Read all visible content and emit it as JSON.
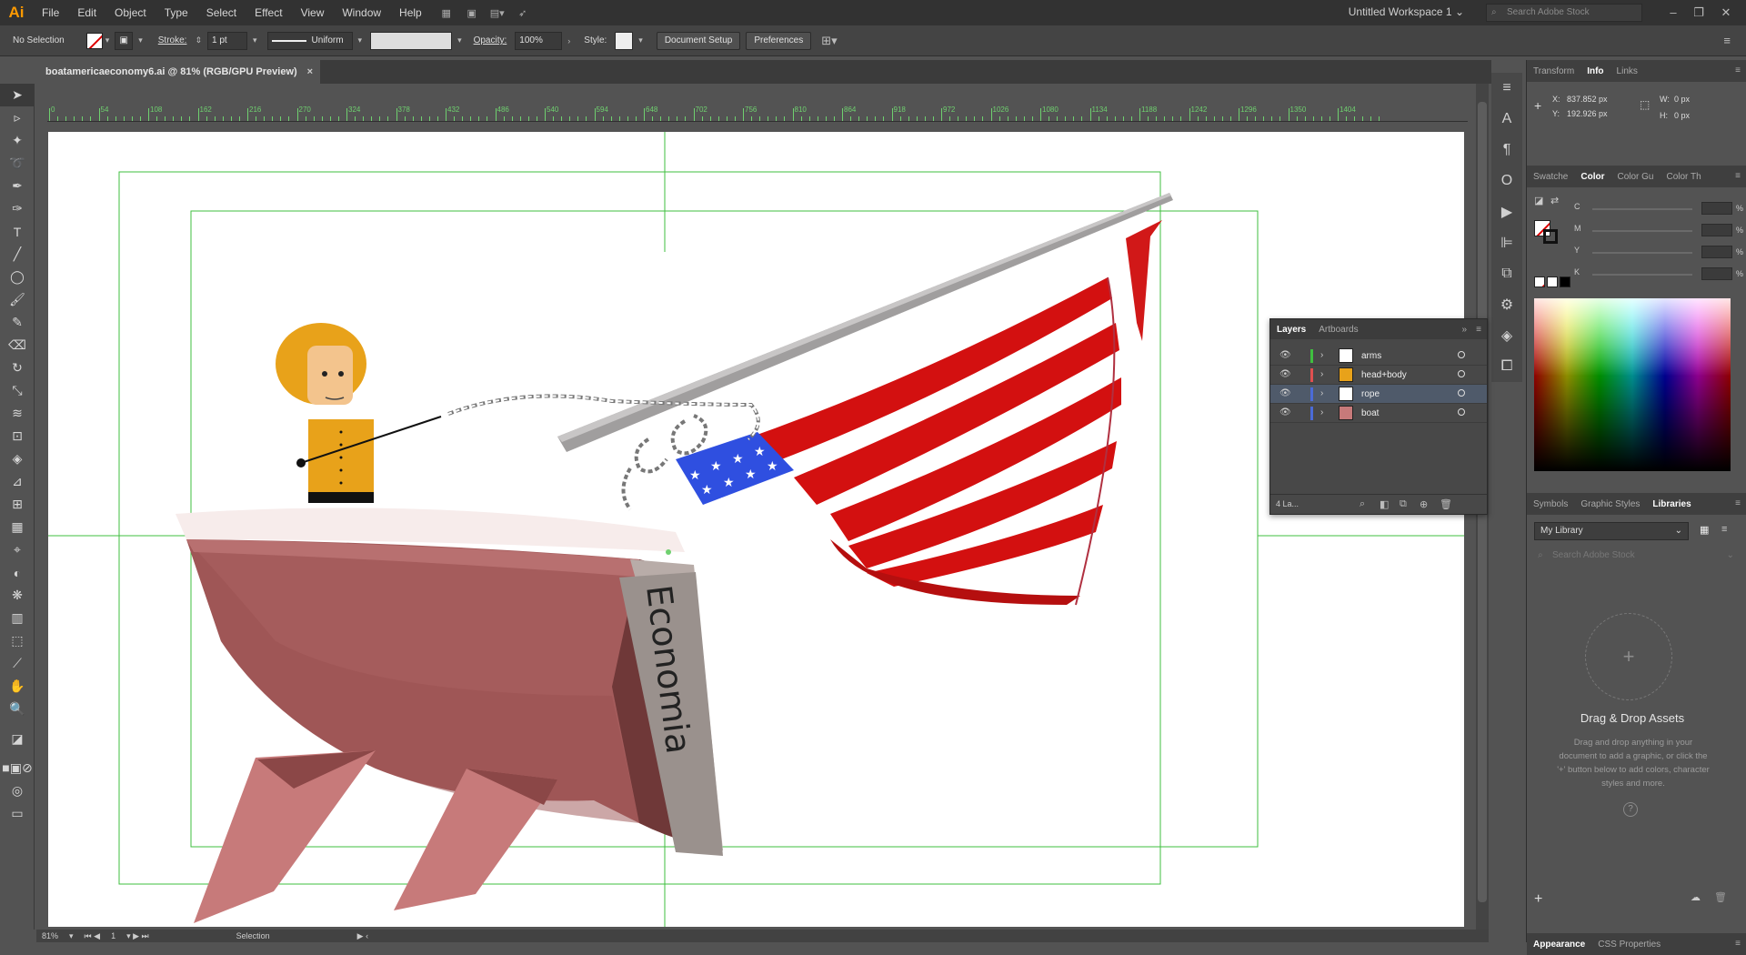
{
  "app": {
    "logo": "Ai"
  },
  "menu": [
    "File",
    "Edit",
    "Object",
    "Type",
    "Select",
    "Effect",
    "View",
    "Window",
    "Help"
  ],
  "workspace": "Untitled Workspace 1",
  "stock_search_placeholder": "Search Adobe Stock",
  "control_bar": {
    "selection_label": "No Selection",
    "stroke_label": "Stroke:",
    "stroke_weight": "1 pt",
    "stroke_profile": "Uniform",
    "opacity_label": "Opacity:",
    "opacity_value": "100%",
    "style_label": "Style:",
    "document_setup": "Document Setup",
    "preferences": "Preferences"
  },
  "document": {
    "tab_title": "boatamericaeconomy6.ai @ 81% (RGB/GPU Preview)",
    "close": "×"
  },
  "ruler_labels": [
    "0",
    "54",
    "108",
    "162",
    "216",
    "270",
    "324",
    "378",
    "432",
    "486",
    "540",
    "594",
    "648",
    "702",
    "756",
    "810",
    "864",
    "918",
    "972",
    "1026",
    "1080",
    "1134",
    "1188",
    "1242",
    "1296",
    "1350",
    "1404"
  ],
  "artwork": {
    "boat_text": "Economia"
  },
  "status": {
    "zoom": "81%",
    "artboard": "1",
    "tool": "Selection"
  },
  "info_panel": {
    "tabs": [
      "Transform",
      "Info",
      "Links"
    ],
    "active_tab": "Info",
    "x_label": "X:",
    "x_value": "837.852 px",
    "y_label": "Y:",
    "y_value": "192.926 px",
    "w_label": "W:",
    "w_value": "0 px",
    "h_label": "H:",
    "h_value": "0 px"
  },
  "color_panel": {
    "tabs": [
      "Swatche",
      "Color",
      "Color Gu",
      "Color Th"
    ],
    "active_tab": "Color",
    "channels": [
      "C",
      "M",
      "Y",
      "K"
    ],
    "percent": "%"
  },
  "libraries_panel": {
    "tabs": [
      "Symbols",
      "Graphic Styles",
      "Libraries"
    ],
    "active_tab": "Libraries",
    "library": "My Library",
    "search_placeholder": "Search Adobe Stock",
    "drop_title": "Drag & Drop Assets",
    "drop_description": "Drag and drop anything in your document to add a graphic, or click the '+' button below to add colors, character styles and more."
  },
  "bottom_tabs": [
    "Appearance",
    "CSS Properties"
  ],
  "layers_panel": {
    "tabs": [
      "Layers",
      "Artboards"
    ],
    "active_tab": "Layers",
    "layers": [
      {
        "name": "arms",
        "color": "#3fbf3f"
      },
      {
        "name": "head+body",
        "color": "#e05050"
      },
      {
        "name": "rope",
        "color": "#4b6bd8"
      },
      {
        "name": "boat",
        "color": "#4b6bd8"
      }
    ],
    "selected_layer": "rope",
    "count": "4 La..."
  },
  "colors": {
    "guide": "#3fbf3f",
    "hull": "#a55c5c",
    "flag_red": "#cc1111",
    "flag_blue": "#3355dd",
    "figure": "#e8a21a"
  }
}
